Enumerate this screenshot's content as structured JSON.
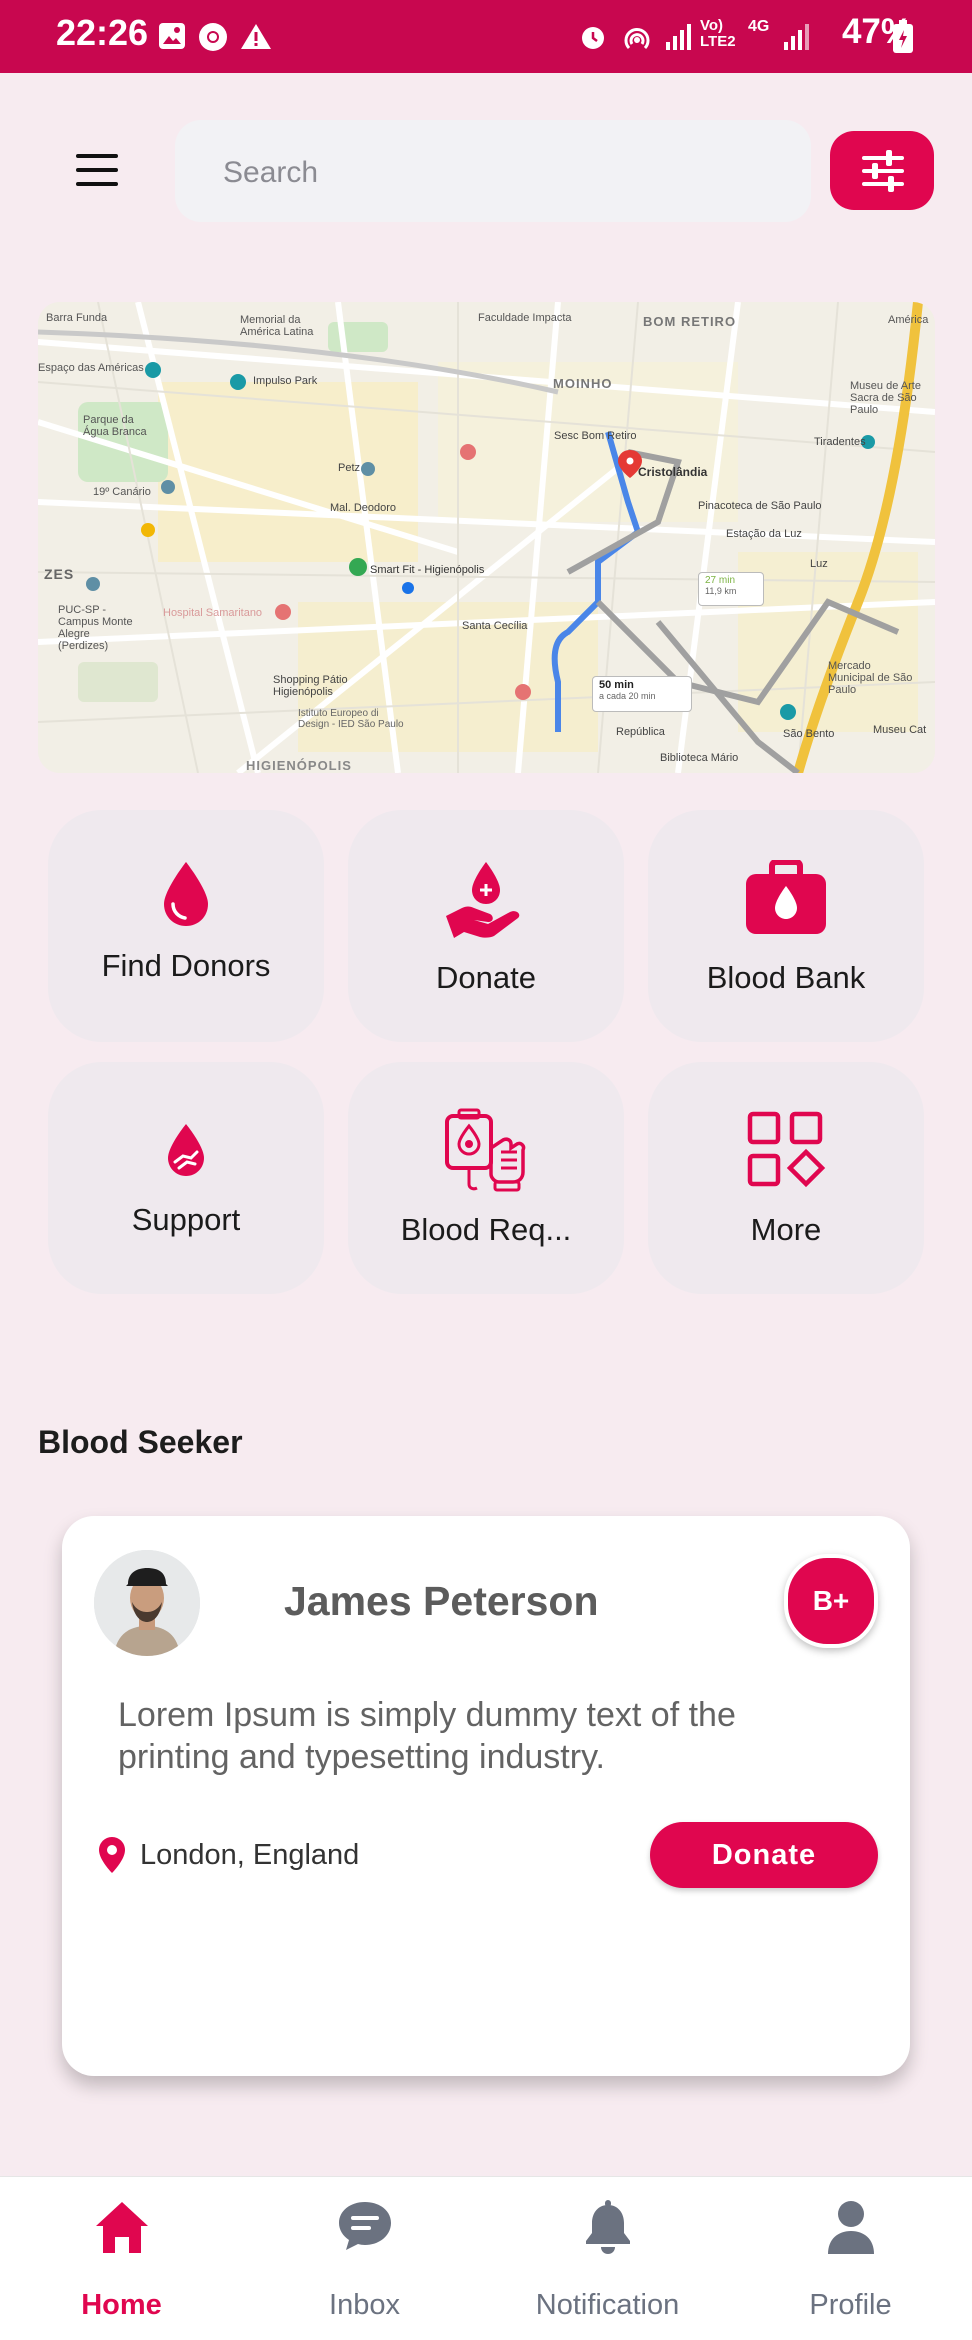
{
  "status_bar": {
    "time": "22:26",
    "battery": "47%",
    "network": "4G",
    "icons": [
      "gallery-icon",
      "chrome-icon",
      "warning-icon",
      "alarm-icon",
      "hotspot-icon",
      "signal-icon",
      "volte-icon",
      "battery-icon"
    ]
  },
  "header": {
    "menu_icon": "hamburger-icon",
    "search_placeholder": "Search",
    "filter_icon": "sliders-icon"
  },
  "map": {
    "labels": {
      "bom_retiro": "BOM RETIRO",
      "moinho": "MOINHO",
      "cristolandia": "Cristolândia",
      "zes": "ZES",
      "higienopolis": "HIGIENÓPOLIS",
      "smart_fit": "Smart Fit - Higienópolis",
      "santa_cecilia": "Santa Cecília",
      "shopping": "Shopping Pátio Higienópolis",
      "puc": "PUC-SP - Campus Monte Alegre (Perdizes)",
      "parque": "Parque da Água Branca",
      "memorial": "Memorial da América Latina",
      "impulso": "Impulso Park",
      "mal_deodoro": "Mal. Deodoro",
      "petz": "Petz",
      "museu_arte": "Museu de Arte Sacra de São Paulo",
      "tiradentes": "Tiradentes",
      "pinacoteca": "Pinacoteca de São Paulo",
      "estacao_luz": "Estação da Luz",
      "luz": "Luz",
      "mercado": "Mercado Municipal de São Paulo",
      "republica": "República",
      "biblioteca": "Biblioteca Mário",
      "sao_bento": "São Bento",
      "museu_cat": "Museu Cat",
      "istituto": "Istituto Europeo di Design - IED São Paulo",
      "hospital": "Hospital Samaritano",
      "faculdade": "Faculdade Impacta",
      "barra_funda": "Barra Funda",
      "america": "América",
      "espaco": "Espaço das Américas",
      "canario": "19º Canário",
      "sesc": "Sesc Bom Retiro"
    },
    "route_time": "50 min",
    "route_dist": "a cada 20 min",
    "alt_time": "27 min",
    "alt_dist": "11,9 km"
  },
  "tiles": [
    {
      "label": "Find Donors",
      "icon": "blood-drop-icon"
    },
    {
      "label": "Donate",
      "icon": "donate-hand-icon"
    },
    {
      "label": "Blood Bank",
      "icon": "blood-bank-icon"
    },
    {
      "label": "Support",
      "icon": "support-icon"
    },
    {
      "label": "Blood Req...",
      "icon": "blood-request-icon"
    },
    {
      "label": "More",
      "icon": "grid-more-icon"
    }
  ],
  "section": {
    "title": "Blood Seeker"
  },
  "seeker_card": {
    "name": "James Peterson",
    "blood_group": "B+",
    "description": "Lorem Ipsum is simply dummy text of the printing and typesetting industry.",
    "location": "London, England",
    "donate_label": "Donate"
  },
  "bottom_nav": [
    {
      "label": "Home",
      "icon": "home-icon",
      "active": true
    },
    {
      "label": "Inbox",
      "icon": "chat-icon",
      "active": false
    },
    {
      "label": "Notification",
      "icon": "bell-icon",
      "active": false
    },
    {
      "label": "Profile",
      "icon": "user-icon",
      "active": false
    }
  ],
  "colors": {
    "primary": "#e0064f",
    "status_bar": "#c8074f",
    "background": "#f7ebf0",
    "tile": "#efe9ee",
    "nav_inactive": "#6b7280"
  }
}
